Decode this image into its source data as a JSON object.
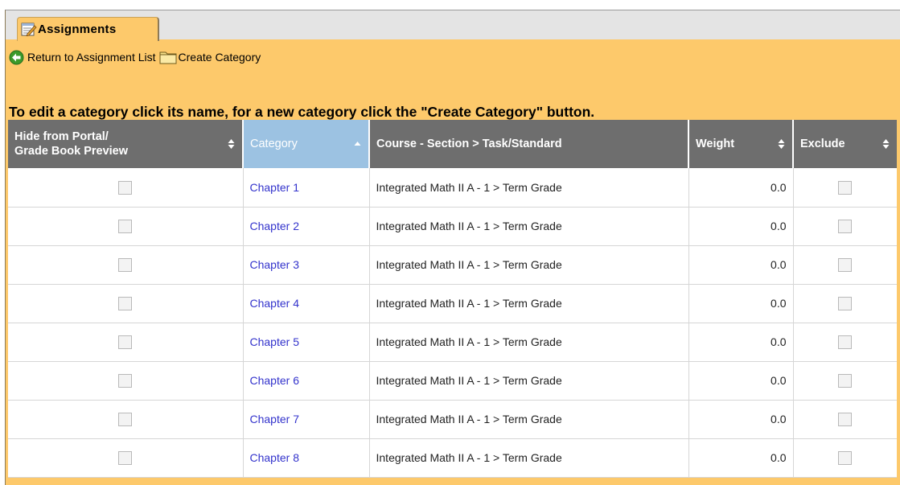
{
  "tab": {
    "label": "Assignments",
    "icon": "assignment-edit-icon"
  },
  "toolbar": {
    "return_label": "Return to Assignment List",
    "return_icon": "back-arrow-icon",
    "create_label": "Create Category",
    "create_icon": "folder-icon"
  },
  "instruction": "To edit a category click its name, for a new category click the \"Create Category\" button.",
  "table": {
    "headers": {
      "hide": [
        "Hide from Portal/",
        "Grade Book Preview"
      ],
      "category": "Category",
      "course": "Course - Section > Task/Standard",
      "weight": "Weight",
      "exclude": "Exclude"
    },
    "sorted_column": "category",
    "sort_direction": "ascending",
    "rows": [
      {
        "category": "Chapter 1",
        "course": "Integrated Math II A - 1 > Term Grade",
        "weight": "0.0",
        "hide": false,
        "exclude": false
      },
      {
        "category": "Chapter 2",
        "course": "Integrated Math II A - 1 > Term Grade",
        "weight": "0.0",
        "hide": false,
        "exclude": false
      },
      {
        "category": "Chapter 3",
        "course": "Integrated Math II A - 1 > Term Grade",
        "weight": "0.0",
        "hide": false,
        "exclude": false
      },
      {
        "category": "Chapter 4",
        "course": "Integrated Math II A - 1 > Term Grade",
        "weight": "0.0",
        "hide": false,
        "exclude": false
      },
      {
        "category": "Chapter 5",
        "course": "Integrated Math II A - 1 > Term Grade",
        "weight": "0.0",
        "hide": false,
        "exclude": false
      },
      {
        "category": "Chapter 6",
        "course": "Integrated Math II A - 1 > Term Grade",
        "weight": "0.0",
        "hide": false,
        "exclude": false
      },
      {
        "category": "Chapter 7",
        "course": "Integrated Math II A - 1 > Term Grade",
        "weight": "0.0",
        "hide": false,
        "exclude": false
      },
      {
        "category": "Chapter 8",
        "course": "Integrated Math II A - 1 > Term Grade",
        "weight": "0.0",
        "hide": false,
        "exclude": false
      }
    ]
  },
  "colors": {
    "panel_bg": "#fdc96b",
    "header_bg": "#6e6e6e",
    "sorted_header_bg": "#9cc2e2",
    "link": "#3333cc",
    "back_icon": "#3c9a2a"
  }
}
